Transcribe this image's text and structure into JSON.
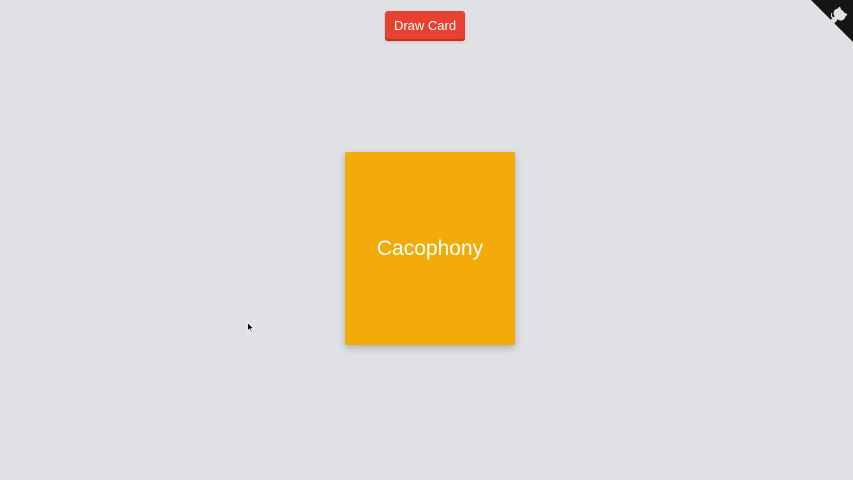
{
  "toolbar": {
    "draw_label": "Draw Card"
  },
  "card": {
    "word": "Cacophony"
  },
  "corner": {
    "icon": "github-octocat-icon"
  },
  "colors": {
    "background": "#e0e1e5",
    "button": "#e8412f",
    "card": "#f3ab09",
    "corner": "#151513"
  }
}
